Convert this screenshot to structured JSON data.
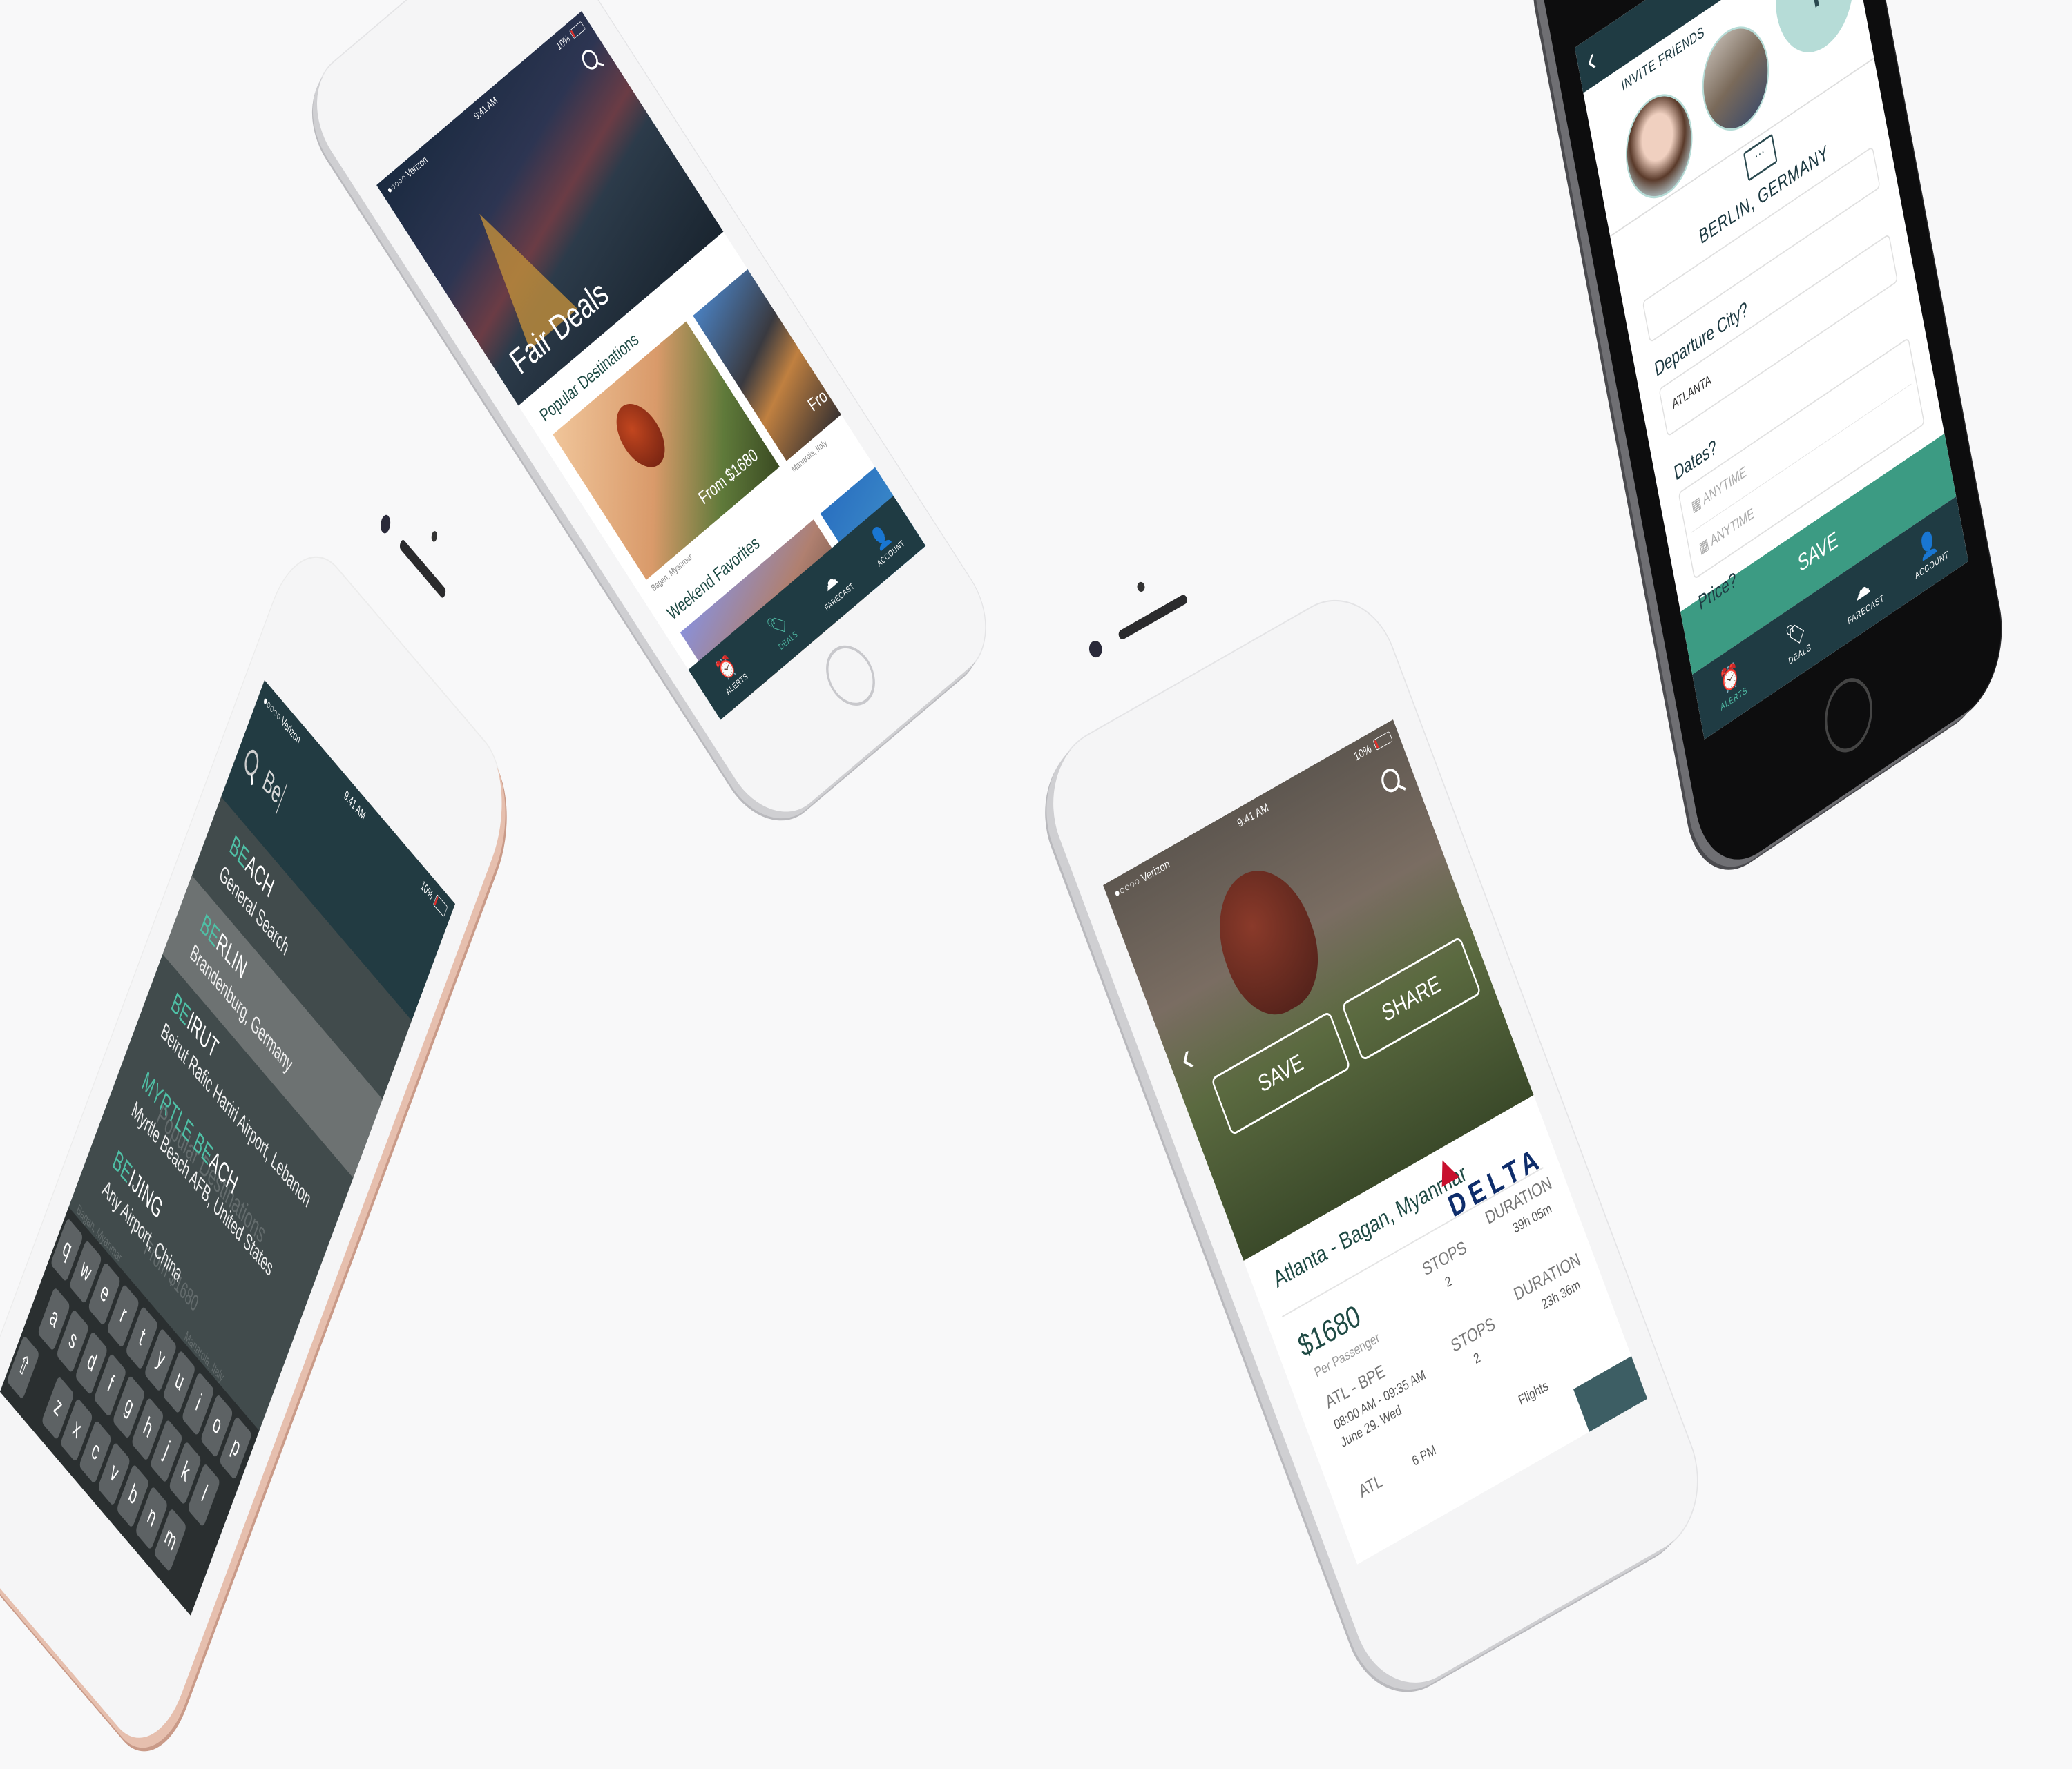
{
  "status": {
    "carrier": "●○○○○ Verizon",
    "time": "9:41 AM",
    "battery": "10%"
  },
  "tabs": {
    "alerts": "ALERTS",
    "deals": "DEALS",
    "farecast": "FARECAST",
    "account": "ACCOUNT"
  },
  "deals_screen": {
    "hero_title": "Fair Deals",
    "popular_heading": "Popular Destinations",
    "cards": [
      {
        "price": "From $1680",
        "caption": "Bagan, Myanmar"
      },
      {
        "price": "Fro",
        "caption": "Manarola, Italy"
      }
    ],
    "weekend_heading": "Weekend Favorites"
  },
  "search_screen": {
    "query": "Be",
    "results": [
      {
        "match": "BE",
        "rest": "ACH",
        "sub": "General Search"
      },
      {
        "match": "BE",
        "rest": "RLIN",
        "sub": "Brandenburg, Germany"
      },
      {
        "match": "BE",
        "rest": "IRUT",
        "sub": "Beirut Rafic Hariri Airport, Lebanon"
      },
      {
        "match": "MYRTLE BE",
        "rest": "ACH",
        "sub": "Myrtle Beach AFB, United States"
      },
      {
        "match": "BE",
        "rest": "IJING",
        "sub": "Any Airport, China"
      }
    ],
    "background_heading": "Popular Destinations",
    "background_price": "From $1680",
    "background_caption": "Bagan, Myanmar",
    "background_caption2": "Manarola, Italy",
    "keyboard_rows": [
      [
        "q",
        "w",
        "e",
        "r",
        "t",
        "y",
        "u",
        "i",
        "o",
        "p"
      ],
      [
        "a",
        "s",
        "d",
        "f",
        "g",
        "h",
        "j",
        "k",
        "l"
      ],
      [
        "⇧",
        "z",
        "x",
        "c",
        "v",
        "b",
        "n",
        "m"
      ]
    ]
  },
  "flight_screen": {
    "save_label": "SAVE",
    "share_label": "SHARE",
    "route_title": "Atlanta - Bagan, Myanmar",
    "airline": "DELTA",
    "price": "$1680",
    "price_note": "Per Passenger",
    "outbound": {
      "route": "ATL - BPE",
      "times": "08:00 AM - 09:35 AM",
      "date": "June 29, Wed"
    },
    "stops_label": "STOPS",
    "stops_1": "2",
    "stops_2": "2",
    "duration_label": "DURATION",
    "duration_1": "39h 05m",
    "duration_2": "23h 36m",
    "return_route": "ATL",
    "return_time": "6 PM",
    "flights_label": "Flights"
  },
  "alert_form": {
    "header": "INVITE FRIENDS",
    "destination": "BERLIN, GERMANY",
    "departure_label": "Departure City?",
    "departure_value": "ATLANTA",
    "dates_label": "Dates?",
    "date_from": "ANYTIME",
    "date_to": "ANYTIME",
    "price_label": "Price?",
    "save_label": "SAVE"
  },
  "colors": {
    "teal_dark": "#1f3b43",
    "accent": "#4fb8a2",
    "save_green": "#3c9b83",
    "delta_blue": "#0e2d6b",
    "delta_red": "#c8102e"
  }
}
